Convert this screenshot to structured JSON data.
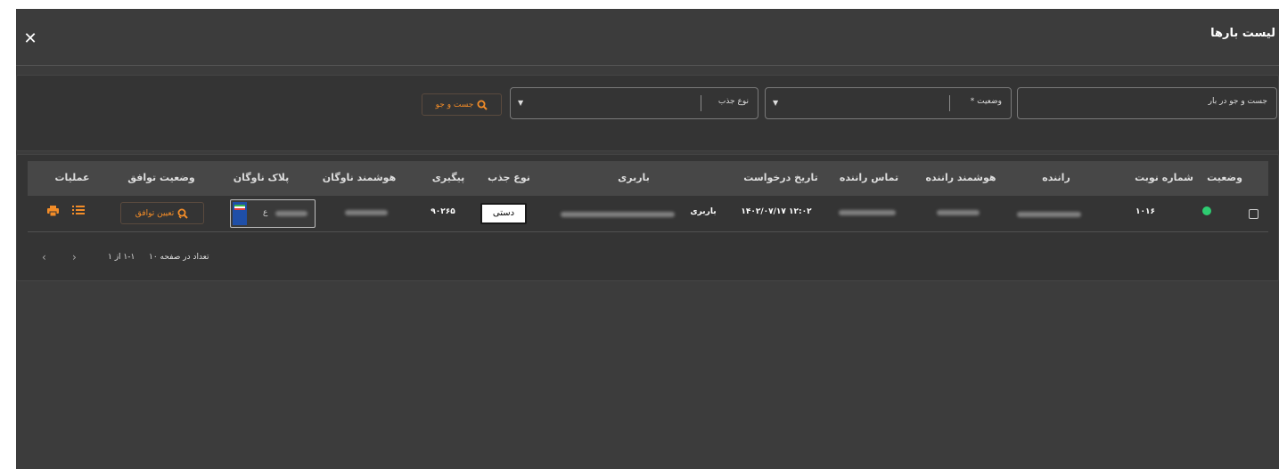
{
  "window": {
    "title": "لیست بارها"
  },
  "filters": {
    "search_label": "جست و جو در بار",
    "status_label": "وضعیت *",
    "traction_label": "نوع جذب",
    "search_button": "جست و جو"
  },
  "table": {
    "headers": {
      "status": "وضعیت",
      "queue_number": "شماره نوبت",
      "driver": "راننده",
      "driver_smart": "هوشمند راننده",
      "driver_contact": "تماس راننده",
      "request_date": "تاریخ درخواست",
      "freight": "باربری",
      "traction_type": "نوع جذب",
      "tracking": "پیگیری",
      "fleet_smart": "هوشمند ناوگان",
      "fleet_plate": "پلاک ناوگان",
      "agreement_status": "وضعیت توافق",
      "operations": "عملیات"
    },
    "rows": [
      {
        "status_color": "#2ecc71",
        "queue_number": "۱۰۱۶",
        "request_date": "۱۴۰۲/۰۷/۱۷ ۱۲:۰۲",
        "freight_prefix": "باربری",
        "traction_type": "دستی",
        "tracking": "۹۰۲۶۵",
        "plate_letter": "ع",
        "agreement_button": "تعیین توافق"
      }
    ]
  },
  "pagination": {
    "per_page_label": "تعداد در صفحه ۱۰",
    "range": "۱-۱ از ۱"
  },
  "colors": {
    "accent": "#f28c28",
    "background": "#3c3c3c",
    "panel": "#343434"
  },
  "icons": [
    "close-icon",
    "search-icon",
    "dropdown-arrow-icon",
    "agreement-search-icon",
    "list-icon",
    "print-icon",
    "chevron-left-icon",
    "chevron-right-icon"
  ]
}
